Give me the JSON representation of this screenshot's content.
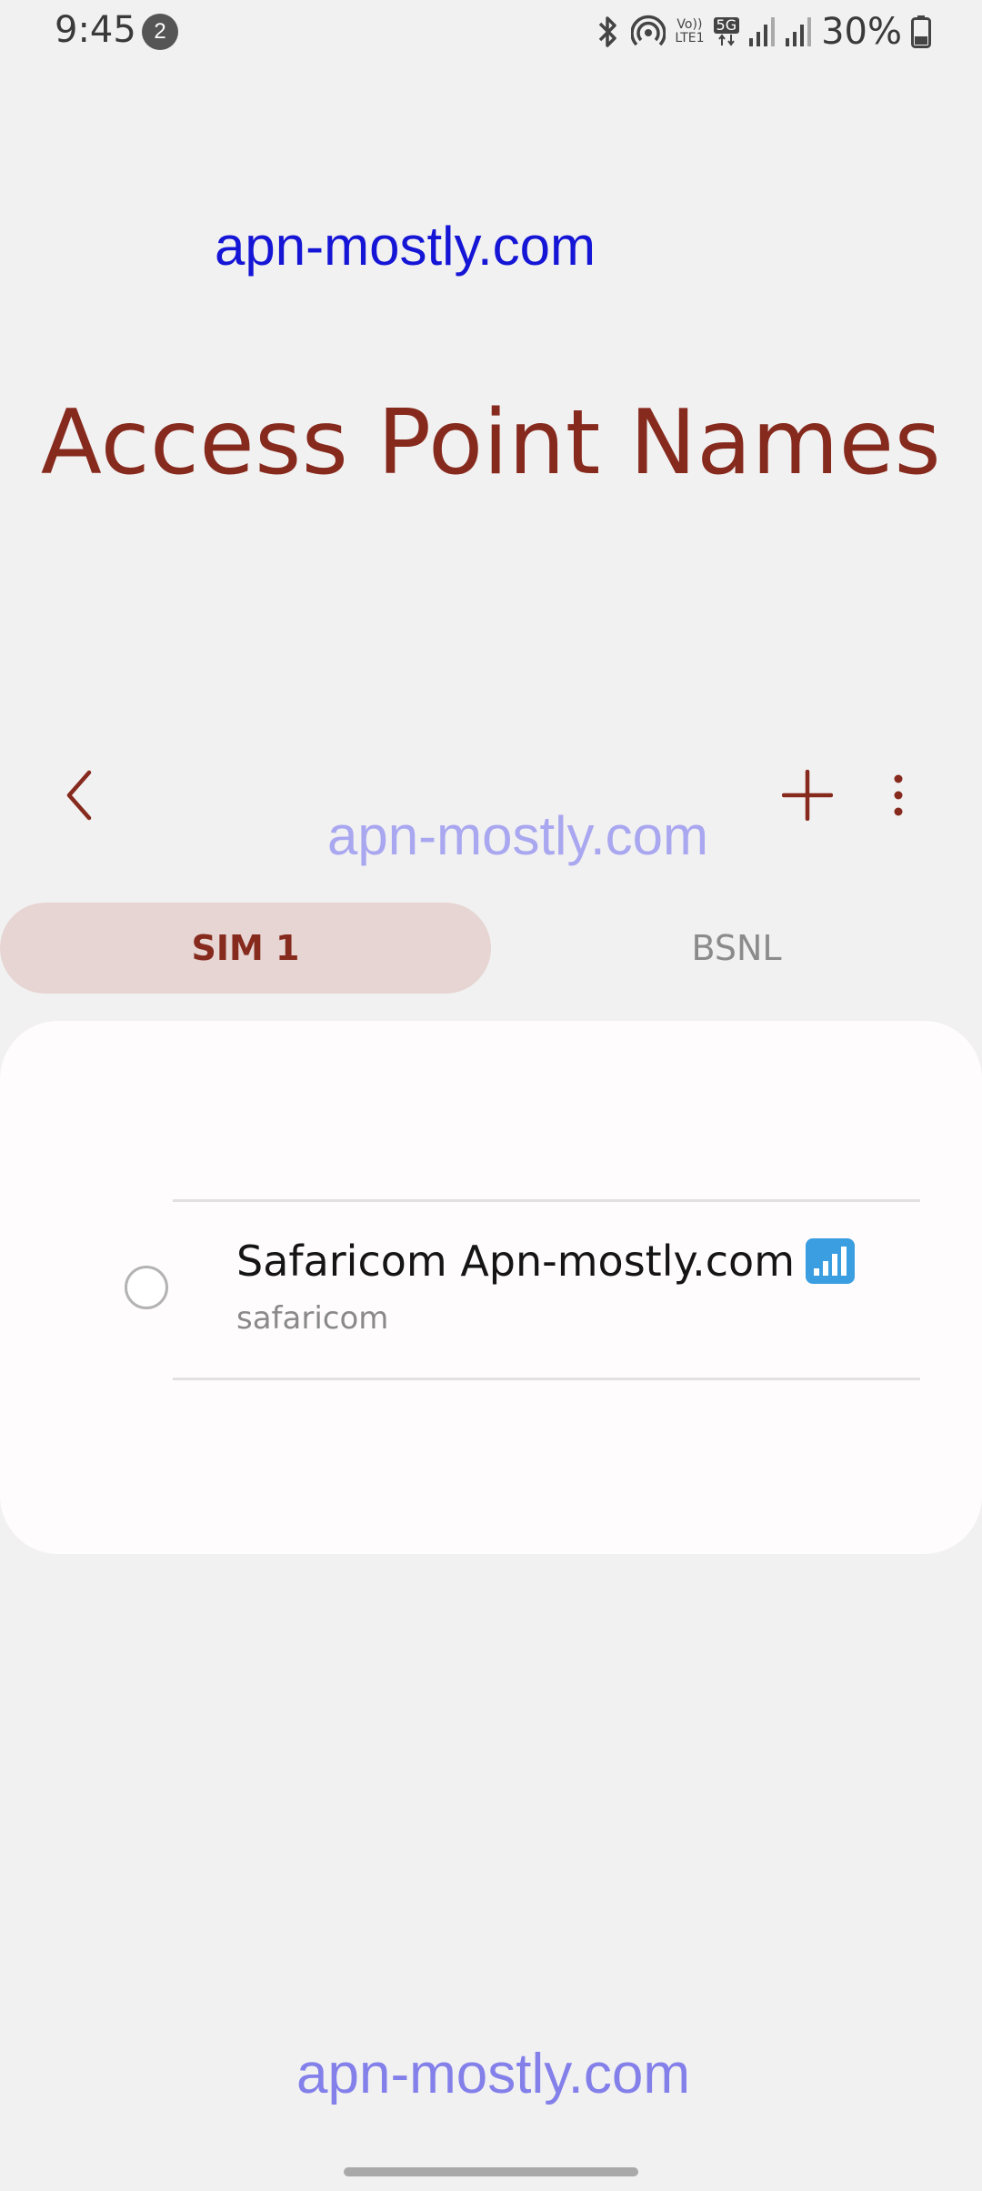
{
  "status_bar": {
    "time": "9:45",
    "notification_count": "2",
    "volte_top": "Vo))",
    "volte_bottom": "LTE1",
    "network_badge": "5G",
    "battery": "30%"
  },
  "watermarks": {
    "top": "apn-mostly.com",
    "middle": "apn-mostly.com",
    "bottom": "apn-mostly.com"
  },
  "title": "Access Point Names",
  "tabs": [
    {
      "label": "SIM 1",
      "selected": true
    },
    {
      "label": "BSNL",
      "selected": false
    }
  ],
  "apn_list": [
    {
      "name": "Safaricom Apn-mostly.com",
      "apn": "safaricom",
      "selected": false
    }
  ],
  "icons": {
    "back": "chevron-left-icon",
    "add": "plus-icon",
    "more": "more-vertical-icon"
  },
  "colors": {
    "accent": "#862a1e",
    "tab_selected_bg": "#e6d5d2",
    "background": "#f2f1f1",
    "card": "#fefcfd"
  }
}
